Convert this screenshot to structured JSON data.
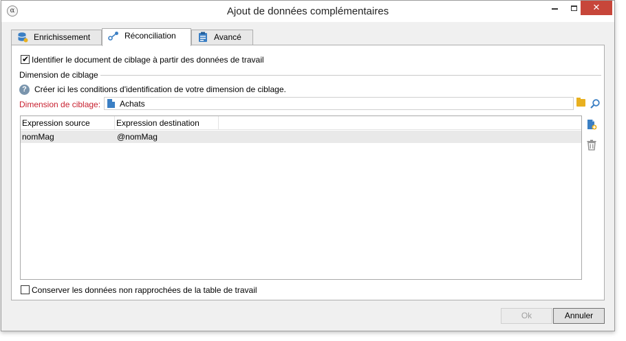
{
  "window": {
    "title": "Ajout de données complémentaires",
    "app_icon": "app-logo-icon",
    "close_color": "#c7463a"
  },
  "tabs": [
    {
      "label": "Enrichissement",
      "icon": "database-star-icon",
      "active": false
    },
    {
      "label": "Réconciliation",
      "icon": "link-nodes-icon",
      "active": true
    },
    {
      "label": "Avancé",
      "icon": "clipboard-icon",
      "active": false
    }
  ],
  "reconciliation": {
    "identify_checkbox": {
      "label": "Identifier le document de ciblage à partir des données de travail",
      "checked": true
    },
    "section_title": "Dimension de ciblage",
    "help_text": "Créer ici les conditions d'identification de votre dimension de ciblage.",
    "dimension_label": "Dimension de ciblage:",
    "dimension_value": "Achats",
    "grid": {
      "columns": [
        "Expression source",
        "Expression destination"
      ],
      "rows": [
        {
          "source": "nomMag",
          "destination": "@nomMag"
        }
      ]
    },
    "keep_checkbox": {
      "label": "Conserver les données non rapprochées de la table de travail",
      "checked": false
    }
  },
  "buttons": {
    "ok": "Ok",
    "cancel": "Annuler"
  },
  "colors": {
    "required_label": "#c8202f",
    "accent": "#3b7fc4"
  }
}
